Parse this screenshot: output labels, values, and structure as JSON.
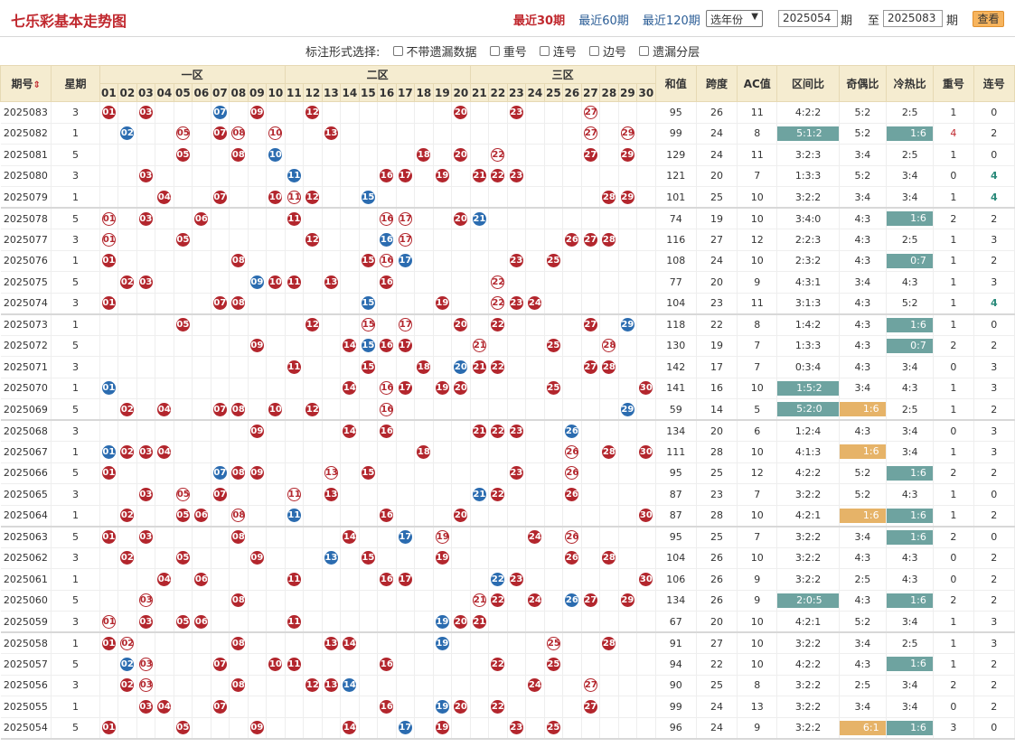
{
  "title": "七乐彩基本走势图",
  "nav": {
    "recent30": "最近30期",
    "recent60": "最近60期",
    "recent120": "最近120期"
  },
  "year_select": "选年份",
  "range": {
    "from": "2025054",
    "to": "2025083",
    "qi1": "期",
    "zhi": "至",
    "qi2": "期",
    "query": "查看"
  },
  "options": {
    "label": "标注形式选择:",
    "items": [
      "不带遗漏数据",
      "重号",
      "连号",
      "边号",
      "遗漏分层"
    ]
  },
  "headers": {
    "issue": "期号",
    "week": "星期",
    "zone1": "一区",
    "zone2": "二区",
    "zone3": "三区",
    "sum": "和值",
    "span": "跨度",
    "ac": "AC值",
    "zone_ratio": "区间比",
    "odd_even": "奇偶比",
    "hot_cold": "冷热比",
    "repeat": "重号",
    "consec": "连号",
    "nums": [
      "01",
      "02",
      "03",
      "04",
      "05",
      "06",
      "07",
      "08",
      "09",
      "10",
      "11",
      "12",
      "13",
      "14",
      "15",
      "16",
      "17",
      "18",
      "19",
      "20",
      "21",
      "22",
      "23",
      "24",
      "25",
      "26",
      "27",
      "28",
      "29",
      "30"
    ]
  },
  "rows": [
    {
      "id": "2025083",
      "w": "3",
      "hit": [
        1,
        3,
        7,
        9,
        12,
        20,
        23,
        27
      ],
      "sp": [
        7
      ],
      "sum": "95",
      "span": "26",
      "ac": "11",
      "zr": "4:2:2",
      "oe": "5:2",
      "hc": "2:5",
      "rep": "1",
      "con": "0"
    },
    {
      "id": "2025082",
      "w": "1",
      "hit": [
        2,
        5,
        7,
        8,
        10,
        13,
        27,
        29
      ],
      "sp": [
        2
      ],
      "sum": "99",
      "span": "24",
      "ac": "8",
      "zr": "5:1:2",
      "oe": "5:2",
      "hc": "1:6",
      "rep": "4",
      "con": "2"
    },
    {
      "id": "2025081",
      "w": "5",
      "hit": [
        5,
        8,
        10,
        18,
        20,
        22,
        27,
        29
      ],
      "sp": [
        10
      ],
      "sum": "129",
      "span": "24",
      "ac": "11",
      "zr": "3:2:3",
      "oe": "3:4",
      "hc": "2:5",
      "rep": "1",
      "con": "0"
    },
    {
      "id": "2025080",
      "w": "3",
      "hit": [
        3,
        11,
        16,
        17,
        19,
        21,
        22,
        23
      ],
      "sp": [
        11
      ],
      "sum": "121",
      "span": "20",
      "ac": "7",
      "zr": "1:3:3",
      "oe": "5:2",
      "hc": "3:4",
      "rep": "0",
      "con": "4"
    },
    {
      "id": "2025079",
      "w": "1",
      "hit": [
        4,
        7,
        10,
        11,
        12,
        15,
        28,
        29
      ],
      "sp": [
        15
      ],
      "sum": "101",
      "span": "25",
      "ac": "10",
      "zr": "3:2:2",
      "oe": "3:4",
      "hc": "3:4",
      "rep": "1",
      "con": "4"
    },
    {
      "id": "2025078",
      "w": "5",
      "hit": [
        1,
        3,
        6,
        11,
        16,
        17,
        20,
        21
      ],
      "sp": [
        21
      ],
      "sum": "74",
      "span": "19",
      "ac": "10",
      "zr": "3:4:0",
      "oe": "4:3",
      "hc": "1:6",
      "rep": "2",
      "con": "2"
    },
    {
      "id": "2025077",
      "w": "3",
      "hit": [
        1,
        5,
        12,
        16,
        17,
        26,
        27,
        28
      ],
      "sp": [
        16
      ],
      "sum": "116",
      "span": "27",
      "ac": "12",
      "zr": "2:2:3",
      "oe": "4:3",
      "hc": "2:5",
      "rep": "1",
      "con": "3"
    },
    {
      "id": "2025076",
      "w": "1",
      "hit": [
        1,
        8,
        15,
        16,
        17,
        23,
        25
      ],
      "sp": [
        17
      ],
      "sum": "108",
      "span": "24",
      "ac": "10",
      "zr": "2:3:2",
      "oe": "4:3",
      "hc": "0:7",
      "rep": "1",
      "con": "2"
    },
    {
      "id": "2025075",
      "w": "5",
      "hit": [
        2,
        3,
        9,
        10,
        11,
        13,
        16,
        22
      ],
      "sp": [
        9
      ],
      "sum": "77",
      "span": "20",
      "ac": "9",
      "zr": "4:3:1",
      "oe": "3:4",
      "hc": "4:3",
      "rep": "1",
      "con": "3"
    },
    {
      "id": "2025074",
      "w": "3",
      "hit": [
        1,
        7,
        8,
        15,
        19,
        22,
        23,
        24
      ],
      "sp": [
        15
      ],
      "sum": "104",
      "span": "23",
      "ac": "11",
      "zr": "3:1:3",
      "oe": "4:3",
      "hc": "5:2",
      "rep": "1",
      "con": "4"
    },
    {
      "id": "2025073",
      "w": "1",
      "hit": [
        5,
        12,
        15,
        17,
        20,
        22,
        27,
        29
      ],
      "sp": [
        29
      ],
      "sum": "118",
      "span": "22",
      "ac": "8",
      "zr": "1:4:2",
      "oe": "4:3",
      "hc": "1:6",
      "rep": "1",
      "con": "0"
    },
    {
      "id": "2025072",
      "w": "5",
      "hit": [
        9,
        14,
        15,
        16,
        17,
        21,
        25,
        28
      ],
      "sp": [
        15
      ],
      "sum": "130",
      "span": "19",
      "ac": "7",
      "zr": "1:3:3",
      "oe": "4:3",
      "hc": "0:7",
      "rep": "2",
      "con": "2"
    },
    {
      "id": "2025071",
      "w": "3",
      "hit": [
        11,
        15,
        18,
        20,
        21,
        22,
        27,
        28
      ],
      "sp": [
        20
      ],
      "sum": "142",
      "span": "17",
      "ac": "7",
      "zr": "0:3:4",
      "oe": "4:3",
      "hc": "3:4",
      "rep": "0",
      "con": "3"
    },
    {
      "id": "2025070",
      "w": "1",
      "hit": [
        1,
        14,
        16,
        17,
        19,
        20,
        25,
        30
      ],
      "sp": [
        1
      ],
      "sum": "141",
      "span": "16",
      "ac": "10",
      "zr": "1:5:2",
      "oe": "3:4",
      "hc": "4:3",
      "rep": "1",
      "con": "3"
    },
    {
      "id": "2025069",
      "w": "5",
      "hit": [
        2,
        4,
        7,
        8,
        10,
        12,
        16,
        29
      ],
      "sp": [
        29
      ],
      "sum": "59",
      "span": "14",
      "ac": "5",
      "zr": "5:2:0",
      "oe": "1:6",
      "hc": "2:5",
      "rep": "1",
      "con": "2"
    },
    {
      "id": "2025068",
      "w": "3",
      "hit": [
        9,
        14,
        16,
        21,
        22,
        23,
        26
      ],
      "sp": [
        26
      ],
      "sum": "134",
      "span": "20",
      "ac": "6",
      "zr": "1:2:4",
      "oe": "4:3",
      "hc": "3:4",
      "rep": "0",
      "con": "3"
    },
    {
      "id": "2025067",
      "w": "1",
      "hit": [
        1,
        2,
        3,
        4,
        18,
        26,
        28,
        30
      ],
      "sp": [
        1
      ],
      "sum": "111",
      "span": "28",
      "ac": "10",
      "zr": "4:1:3",
      "oe": "1:6",
      "hc": "3:4",
      "rep": "1",
      "con": "3"
    },
    {
      "id": "2025066",
      "w": "5",
      "hit": [
        1,
        7,
        8,
        9,
        13,
        15,
        23,
        26
      ],
      "sp": [
        7
      ],
      "sum": "95",
      "span": "25",
      "ac": "12",
      "zr": "4:2:2",
      "oe": "5:2",
      "hc": "1:6",
      "rep": "2",
      "con": "2"
    },
    {
      "id": "2025065",
      "w": "3",
      "hit": [
        3,
        5,
        7,
        11,
        13,
        21,
        22,
        26
      ],
      "sp": [
        21
      ],
      "sum": "87",
      "span": "23",
      "ac": "7",
      "zr": "3:2:2",
      "oe": "5:2",
      "hc": "4:3",
      "rep": "1",
      "con": "0"
    },
    {
      "id": "2025064",
      "w": "1",
      "hit": [
        2,
        5,
        6,
        8,
        11,
        16,
        20,
        30
      ],
      "sp": [
        11
      ],
      "sum": "87",
      "span": "28",
      "ac": "10",
      "zr": "4:2:1",
      "oe": "1:6",
      "hc": "1:6",
      "rep": "1",
      "con": "2"
    },
    {
      "id": "2025063",
      "w": "5",
      "hit": [
        1,
        3,
        8,
        14,
        17,
        19,
        24,
        26
      ],
      "sp": [
        17
      ],
      "sum": "95",
      "span": "25",
      "ac": "7",
      "zr": "3:2:2",
      "oe": "3:4",
      "hc": "1:6",
      "rep": "2",
      "con": "0"
    },
    {
      "id": "2025062",
      "w": "3",
      "hit": [
        2,
        5,
        9,
        13,
        15,
        19,
        26,
        28
      ],
      "sp": [
        13
      ],
      "sum": "104",
      "span": "26",
      "ac": "10",
      "zr": "3:2:2",
      "oe": "4:3",
      "hc": "4:3",
      "rep": "0",
      "con": "2"
    },
    {
      "id": "2025061",
      "w": "1",
      "hit": [
        4,
        6,
        11,
        16,
        17,
        22,
        23,
        30
      ],
      "sp": [
        22
      ],
      "sum": "106",
      "span": "26",
      "ac": "9",
      "zr": "3:2:2",
      "oe": "2:5",
      "hc": "4:3",
      "rep": "0",
      "con": "2"
    },
    {
      "id": "2025060",
      "w": "5",
      "hit": [
        3,
        8,
        21,
        22,
        24,
        26,
        27,
        29
      ],
      "sp": [
        26
      ],
      "sum": "134",
      "span": "26",
      "ac": "9",
      "zr": "2:0:5",
      "oe": "4:3",
      "hc": "1:6",
      "rep": "2",
      "con": "2"
    },
    {
      "id": "2025059",
      "w": "3",
      "hit": [
        1,
        3,
        5,
        6,
        11,
        19,
        20,
        21
      ],
      "sp": [
        19
      ],
      "sum": "67",
      "span": "20",
      "ac": "10",
      "zr": "4:2:1",
      "oe": "5:2",
      "hc": "3:4",
      "rep": "1",
      "con": "3"
    },
    {
      "id": "2025058",
      "w": "1",
      "hit": [
        1,
        2,
        8,
        13,
        14,
        19,
        25,
        28
      ],
      "sp": [
        19
      ],
      "sum": "91",
      "span": "27",
      "ac": "10",
      "zr": "3:2:2",
      "oe": "3:4",
      "hc": "2:5",
      "rep": "1",
      "con": "3"
    },
    {
      "id": "2025057",
      "w": "5",
      "hit": [
        2,
        3,
        7,
        10,
        11,
        16,
        22,
        25
      ],
      "sp": [
        2
      ],
      "sum": "94",
      "span": "22",
      "ac": "10",
      "zr": "4:2:2",
      "oe": "4:3",
      "hc": "1:6",
      "rep": "1",
      "con": "2"
    },
    {
      "id": "2025056",
      "w": "3",
      "hit": [
        2,
        3,
        8,
        12,
        13,
        14,
        24,
        27
      ],
      "sp": [
        14
      ],
      "sum": "90",
      "span": "25",
      "ac": "8",
      "zr": "3:2:2",
      "oe": "2:5",
      "hc": "3:4",
      "rep": "2",
      "con": "2"
    },
    {
      "id": "2025055",
      "w": "1",
      "hit": [
        3,
        4,
        7,
        16,
        19,
        20,
        22,
        27
      ],
      "sp": [
        19
      ],
      "sum": "99",
      "span": "24",
      "ac": "13",
      "zr": "3:2:2",
      "oe": "3:4",
      "hc": "3:4",
      "rep": "0",
      "con": "2"
    },
    {
      "id": "2025054",
      "w": "5",
      "hit": [
        1,
        5,
        9,
        14,
        17,
        19,
        23,
        25
      ],
      "sp": [
        17
      ],
      "sum": "96",
      "span": "24",
      "ac": "9",
      "zr": "3:2:2",
      "oe": "6:1",
      "hc": "1:6",
      "rep": "3",
      "con": "0"
    }
  ],
  "highlight": {
    "zr": [
      "5:1:2",
      "1:5:2",
      "5:2:0",
      "2:0:5"
    ],
    "oe": [
      "1:6",
      "6:1"
    ],
    "hc": [
      "1:6",
      "0:7"
    ]
  },
  "colors": {
    "red": "#b3262d",
    "blue": "#2b6cb0",
    "teal": "#6ea3a0",
    "amber": "#e6b368",
    "header": "#f5ecd0"
  },
  "icons": {
    "sort": "sort-arrows-icon",
    "checkbox": "checkbox-icon"
  }
}
